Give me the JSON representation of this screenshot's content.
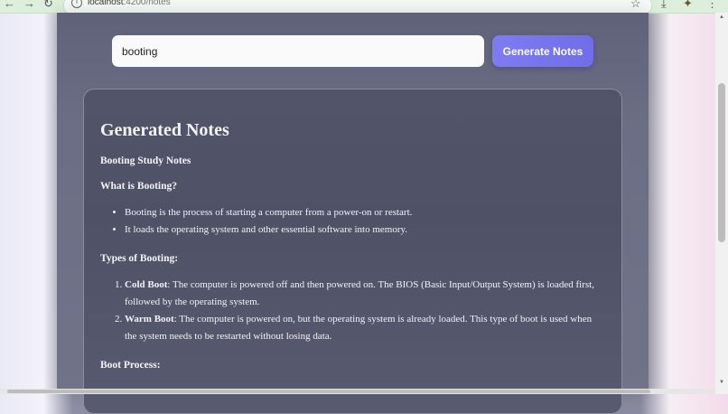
{
  "browser": {
    "url_host": "localhost",
    "url_path": ":4200/notes"
  },
  "app": {
    "search_value": "booting",
    "generate_button": "Generate Notes"
  },
  "notes": {
    "title": "Generated Notes",
    "study_title": "Booting Study Notes",
    "what_heading": "What is Booting?",
    "what_items": [
      "Booting is the process of starting a computer from a power-on or restart.",
      "It loads the operating system and other essential software into memory."
    ],
    "types_heading": "Types of Booting:",
    "types_items": [
      {
        "term": "Cold Boot",
        "text": ": The computer is powered off and then powered on. The BIOS (Basic Input/Output System) is loaded first, followed by the operating system."
      },
      {
        "term": "Warm Boot",
        "text": ": The computer is powered on, but the operating system is already loaded. This type of boot is used when the system needs to be restarted without losing data."
      }
    ],
    "process_heading": "Boot Process:"
  }
}
